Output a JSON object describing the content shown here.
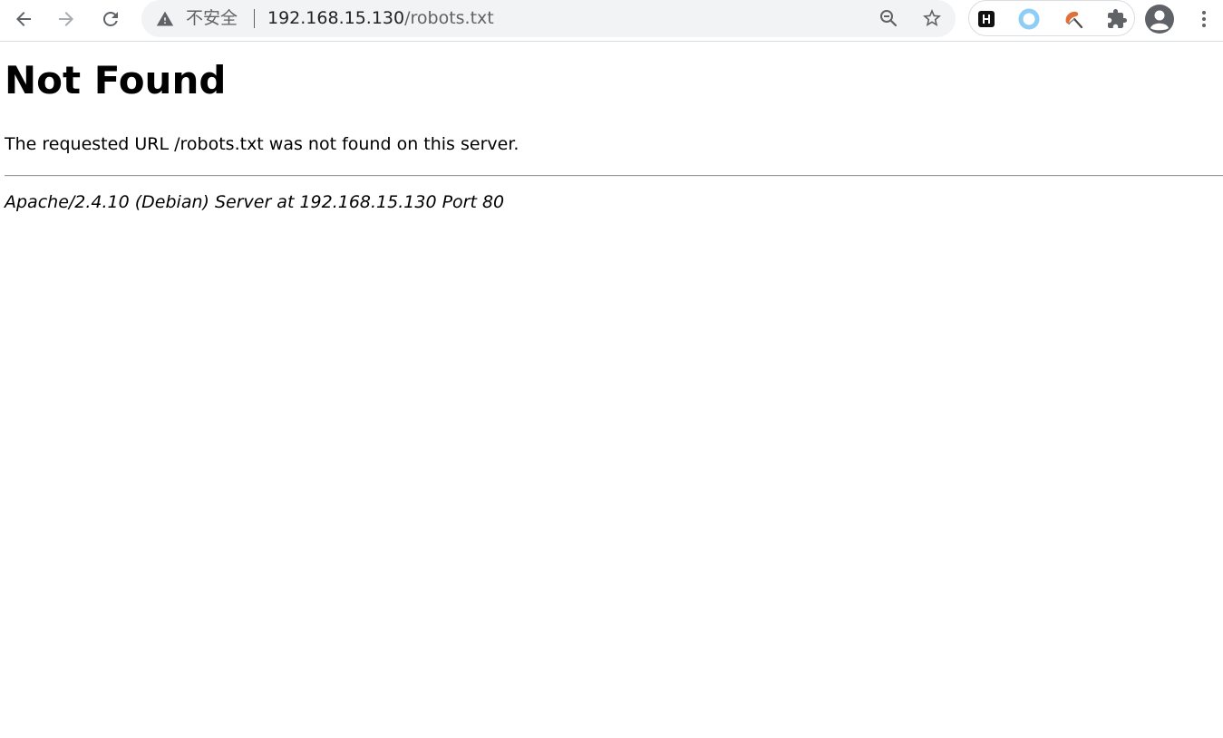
{
  "browser": {
    "security_label": "不安全",
    "url_host": "192.168.15.130",
    "url_path": "/robots.txt",
    "icons": {
      "back": "arrow-left-icon",
      "forward": "arrow-right-icon",
      "reload": "reload-icon",
      "security": "warning-triangle-icon",
      "zoom": "zoom-out-icon",
      "bookmark": "star-icon",
      "extensions": [
        "h-extension-icon",
        "ring-extension-icon",
        "brush-extension-icon",
        "puzzle-extensions-icon"
      ],
      "profile": "profile-avatar-icon",
      "menu": "kebab-menu-icon"
    },
    "colors": {
      "icon": "#5f6368",
      "omnibox_bg": "#f1f3f4",
      "ring_extension": "#8ecdf5",
      "brush_extension": "#e0703a"
    }
  },
  "page": {
    "heading": "Not Found",
    "message": "The requested URL /robots.txt was not found on this server.",
    "signature": "Apache/2.4.10 (Debian) Server at 192.168.15.130 Port 80"
  }
}
